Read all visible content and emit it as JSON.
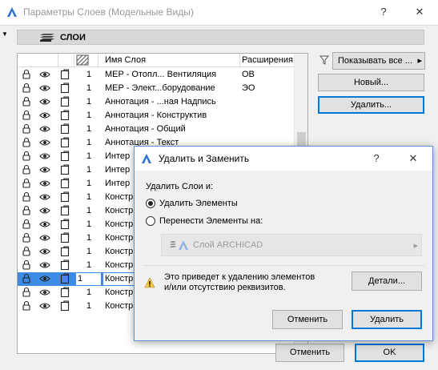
{
  "window": {
    "title": "Параметры Слоев (Модельные Виды)",
    "help_glyph": "?",
    "close_glyph": "✕"
  },
  "section": {
    "title": "СЛОИ",
    "collapse_glyph": "▼"
  },
  "table": {
    "headers": {
      "name": "Имя Слоя",
      "ext": "Расширения"
    },
    "rows": [
      {
        "num": "1",
        "name": "MEP - Отопл... Вентиляция",
        "ext": "OB"
      },
      {
        "num": "1",
        "name": "MEP - Элект...борудование",
        "ext": "ЭO"
      },
      {
        "num": "1",
        "name": "Аннотация - ...ная Надпись",
        "ext": ""
      },
      {
        "num": "1",
        "name": "Аннотация - Конструктив",
        "ext": ""
      },
      {
        "num": "1",
        "name": "Аннотация - Общий",
        "ext": ""
      },
      {
        "num": "1",
        "name": "Аннотация - Текст",
        "ext": ""
      },
      {
        "num": "1",
        "name": "Интер",
        "ext": ""
      },
      {
        "num": "1",
        "name": "Интер",
        "ext": ""
      },
      {
        "num": "1",
        "name": "Интер",
        "ext": ""
      },
      {
        "num": "1",
        "name": "Констр",
        "ext": ""
      },
      {
        "num": "1",
        "name": "Констр",
        "ext": ""
      },
      {
        "num": "1",
        "name": "Констр",
        "ext": ""
      },
      {
        "num": "1",
        "name": "Констр",
        "ext": ""
      },
      {
        "num": "1",
        "name": "Констр",
        "ext": ""
      },
      {
        "num": "1",
        "name": "Констр",
        "ext": ""
      },
      {
        "num": "1",
        "name": "Констр",
        "ext": "",
        "selected": true
      },
      {
        "num": "1",
        "name": "Констр",
        "ext": ""
      },
      {
        "num": "1",
        "name": "Констр",
        "ext": ""
      }
    ]
  },
  "side": {
    "filter_dropdown": "Показывать все ...",
    "filter_arrow": "▸",
    "new_button": "Новый...",
    "delete_button": "Удалить..."
  },
  "footer": {
    "cancel": "Отменить",
    "ok": "OK"
  },
  "dialog": {
    "title": "Удалить и Заменить",
    "help_glyph": "?",
    "close_glyph": "✕",
    "prompt": "Удалить Слои и:",
    "option_delete": "Удалить Элементы",
    "option_move": "Перенести Элементы на:",
    "target_layer": "Слой ARCHICAD",
    "dd_arrow": "▸",
    "warning_line1": "Это приведет к удалению элементов",
    "warning_line2": "и/или отсутствию реквизитов.",
    "details_button": "Детали...",
    "cancel_button": "Отменить",
    "delete_button": "Удалить"
  },
  "colors": {
    "selection": "#3c8ce6",
    "default_button_border": "#0078d7",
    "warning": "#f7c948"
  }
}
